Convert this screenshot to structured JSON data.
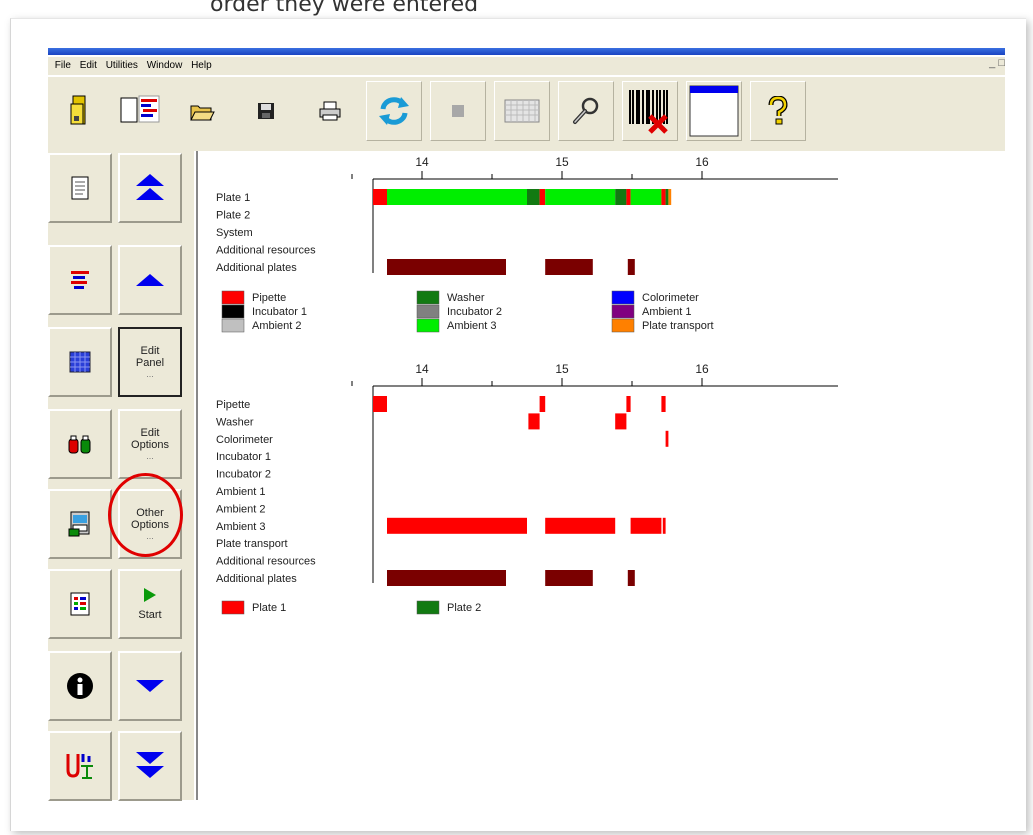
{
  "caption": "order they were entered",
  "menu": [
    "File",
    "Edit",
    "Utilities",
    "Window",
    "Help"
  ],
  "toolbar": {
    "icons": [
      "tray-icon",
      "new-file-icon",
      "open-folder-icon",
      "save-icon",
      "print-icon",
      "refresh-icon",
      "stop-icon",
      "grid-icon",
      "wrench-icon",
      "barcode-icon",
      "window-icon",
      "help-icon"
    ]
  },
  "left": {
    "edit_panel": "Edit Panel",
    "edit_options": "Edit Options",
    "other_options": "Other Options",
    "start": "Start",
    "ellipsis": "..."
  },
  "colors": {
    "pipette": "#ff0000",
    "washer": "#127a12",
    "colorimeter": "#0000ff",
    "incubator1": "#000000",
    "incubator2": "#808080",
    "ambient1": "#800080",
    "ambient2": "#c0c0c0",
    "ambient3": "#00ee00",
    "plate_transport": "#ff8000",
    "additional_plates": "#7a0000",
    "highlight": "#e00000"
  },
  "chart_data": [
    {
      "type": "gantt",
      "x_ticks": [
        "14",
        "15",
        "16"
      ],
      "rows": [
        "Plate 1",
        "Plate 2",
        "System",
        "Additional resources",
        "Additional plates"
      ],
      "legend": [
        "Pipette",
        "Incubator 1",
        "Ambient 2",
        "Washer",
        "Incubator 2",
        "Ambient 3",
        "Colorimeter",
        "Ambient 1",
        "Plate transport"
      ],
      "bars": [
        {
          "row": "Plate 1",
          "start": 13.65,
          "end": 13.75,
          "resource": "Pipette"
        },
        {
          "row": "Plate 1",
          "start": 13.75,
          "end": 14.75,
          "resource": "Ambient 3"
        },
        {
          "row": "Plate 1",
          "start": 14.75,
          "end": 14.84,
          "resource": "Washer"
        },
        {
          "row": "Plate 1",
          "start": 14.84,
          "end": 14.88,
          "resource": "Pipette"
        },
        {
          "row": "Plate 1",
          "start": 14.88,
          "end": 15.38,
          "resource": "Ambient 3"
        },
        {
          "row": "Plate 1",
          "start": 15.38,
          "end": 15.46,
          "resource": "Washer"
        },
        {
          "row": "Plate 1",
          "start": 15.46,
          "end": 15.49,
          "resource": "Pipette"
        },
        {
          "row": "Plate 1",
          "start": 15.49,
          "end": 15.71,
          "resource": "Ambient 3"
        },
        {
          "row": "Plate 1",
          "start": 15.71,
          "end": 15.74,
          "resource": "Pipette"
        },
        {
          "row": "Plate 1",
          "start": 15.74,
          "end": 15.76,
          "resource": "Washer"
        },
        {
          "row": "Plate 1",
          "start": 15.76,
          "end": 15.78,
          "resource": "Plate transport"
        },
        {
          "row": "Additional plates",
          "start": 13.75,
          "end": 14.6,
          "resource": "Additional plates"
        },
        {
          "row": "Additional plates",
          "start": 14.88,
          "end": 15.22,
          "resource": "Additional plates"
        },
        {
          "row": "Additional plates",
          "start": 15.47,
          "end": 15.52,
          "resource": "Additional plates"
        }
      ]
    },
    {
      "type": "gantt",
      "x_ticks": [
        "14",
        "15",
        "16"
      ],
      "rows": [
        "Pipette",
        "Washer",
        "Colorimeter",
        "Incubator 1",
        "Incubator 2",
        "Ambient 1",
        "Ambient 2",
        "Ambient 3",
        "Plate transport",
        "Additional resources",
        "Additional plates"
      ],
      "legend": [
        "Plate 1",
        "Plate 2"
      ],
      "bars": [
        {
          "row": "Pipette",
          "start": 13.65,
          "end": 13.75,
          "plate": "Plate 1"
        },
        {
          "row": "Pipette",
          "start": 14.84,
          "end": 14.88,
          "plate": "Plate 1"
        },
        {
          "row": "Pipette",
          "start": 15.46,
          "end": 15.49,
          "plate": "Plate 1"
        },
        {
          "row": "Pipette",
          "start": 15.71,
          "end": 15.74,
          "plate": "Plate 1"
        },
        {
          "row": "Washer",
          "start": 14.76,
          "end": 14.84,
          "plate": "Plate 1"
        },
        {
          "row": "Washer",
          "start": 15.38,
          "end": 15.46,
          "plate": "Plate 1"
        },
        {
          "row": "Colorimeter",
          "start": 15.74,
          "end": 15.76,
          "plate": "Plate 1"
        },
        {
          "row": "Ambient 3",
          "start": 13.75,
          "end": 14.75,
          "plate": "Plate 1"
        },
        {
          "row": "Ambient 3",
          "start": 14.88,
          "end": 15.38,
          "plate": "Plate 1"
        },
        {
          "row": "Ambient 3",
          "start": 15.49,
          "end": 15.71,
          "plate": "Plate 1"
        },
        {
          "row": "Ambient 3",
          "start": 15.72,
          "end": 15.74,
          "plate": "Plate 1"
        },
        {
          "row": "Additional plates",
          "start": 13.75,
          "end": 14.6,
          "plate": "Additional plates"
        },
        {
          "row": "Additional plates",
          "start": 14.88,
          "end": 15.22,
          "plate": "Additional plates"
        },
        {
          "row": "Additional plates",
          "start": 15.47,
          "end": 15.52,
          "plate": "Additional plates"
        }
      ]
    }
  ]
}
